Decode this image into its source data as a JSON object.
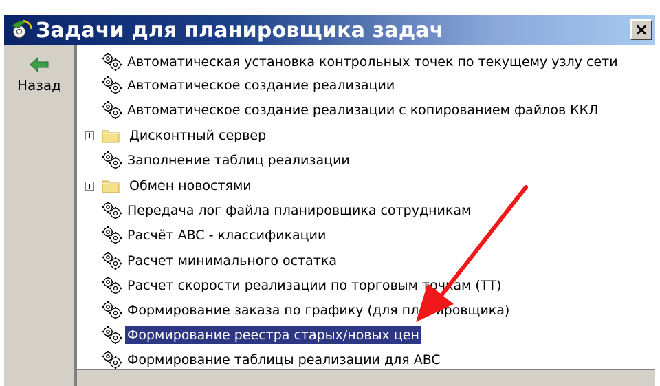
{
  "window": {
    "title": "Задачи для планировщика задач",
    "close_label": "×"
  },
  "sidebar": {
    "back_label": "Назад"
  },
  "tree": {
    "items": [
      {
        "label": "Автоматическая установка контрольных точек по текущему узлу сети",
        "type": "task"
      },
      {
        "label": "Автоматическое создание реализации",
        "type": "task"
      },
      {
        "label": "Автоматическое создание реализации с копированием файлов ККЛ",
        "type": "task"
      },
      {
        "label": "Дисконтный сервер",
        "type": "folder"
      },
      {
        "label": "Заполнение таблиц реализации",
        "type": "task"
      },
      {
        "label": "Обмен новостями",
        "type": "folder"
      },
      {
        "label": "Передача лог файла планировщика сотрудникам",
        "type": "task"
      },
      {
        "label": "Расчёт ABC - классификации",
        "type": "task"
      },
      {
        "label": "Расчет минимального остатка",
        "type": "task"
      },
      {
        "label": "Расчет скорости реализации по торговым точкам (ТТ)",
        "type": "task"
      },
      {
        "label": "Формирование заказа по графику (для планировщика)",
        "type": "task"
      },
      {
        "label": "Формирование реестра старых/новых цен",
        "type": "task",
        "selected": true
      },
      {
        "label": "Формирование таблицы реализации для ABC",
        "type": "task"
      }
    ]
  },
  "colors": {
    "title_start": "#0a246a",
    "title_end": "#a6caf0",
    "selection": "#2d3784",
    "annotation_arrow": "#f01818"
  },
  "icons": {
    "app": "gear-task-icon",
    "back": "green-back-arrow-icon",
    "task": "gear-icon",
    "folder": "folder-icon"
  }
}
